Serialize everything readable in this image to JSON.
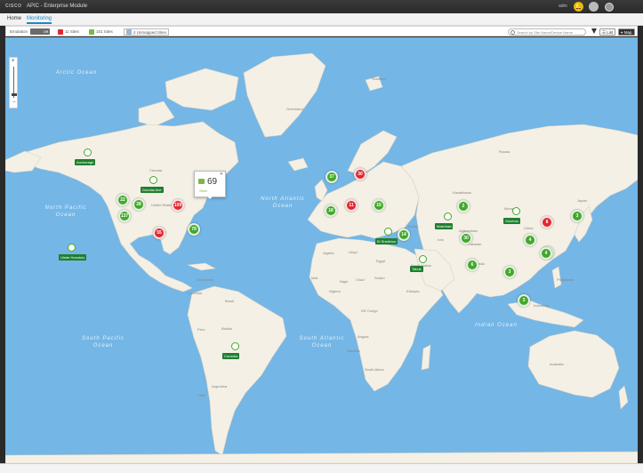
{
  "window": {
    "logo": "CISCO",
    "title": "APIC - Enterprise Module",
    "user": "adm"
  },
  "nav": {
    "tabs": [
      "Home",
      "Monitoring"
    ],
    "active": "Monitoring"
  },
  "toolbar": {
    "emulation_label": "Emulation",
    "emulation_toggle": "Off",
    "unreachable_label": "11 Sites",
    "reachable_label": "101 Sites",
    "unmapped_label": "4 Unmapped Sites",
    "search_placeholder": "Search by Site Name/Device Name",
    "list_label": "List",
    "map_label": "Map"
  },
  "colors": {
    "green": "#43a82b",
    "red": "#e0282f",
    "label_bg": "#1e7f2e",
    "ocean": "#74b6e6",
    "land": "#f4f0e6"
  },
  "map": {
    "oceans": [
      "Arctic Ocean",
      "North Pacific Ocean",
      "North Atlantic Ocean",
      "South Pacific Ocean",
      "South Atlantic Ocean",
      "Indian Ocean"
    ],
    "countries": [
      "Canada",
      "United States",
      "Mexico",
      "Brazil",
      "Peru",
      "Argentina",
      "Venezuela",
      "Colombia",
      "Bolivia",
      "Chile",
      "Greenland",
      "Russia",
      "Kazakhstan",
      "Mongolia",
      "China",
      "India",
      "Iran",
      "Saudi Arabia",
      "Egypt",
      "Libya",
      "Algeria",
      "Sudan",
      "Nigeria",
      "Chad",
      "Niger",
      "Mali",
      "DR Congo",
      "Angola",
      "Ethiopia",
      "South Africa",
      "Namibia",
      "Australia",
      "Indonesia",
      "Turkey",
      "Afghanistan",
      "Pakistan",
      "Japan",
      "Philippines",
      "Svalbard"
    ],
    "clusters": [
      {
        "count": "22",
        "status": "green"
      },
      {
        "count": "28",
        "status": "green"
      },
      {
        "count": "137",
        "status": "green"
      },
      {
        "count": "109",
        "status": "red"
      },
      {
        "count": "55",
        "status": "red"
      },
      {
        "count": "79",
        "status": "green"
      },
      {
        "count": "37",
        "status": "green"
      },
      {
        "count": "30",
        "status": "red"
      },
      {
        "count": "11",
        "status": "red"
      },
      {
        "count": "15",
        "status": "green"
      },
      {
        "count": "18",
        "status": "green"
      },
      {
        "count": "2",
        "status": "green"
      },
      {
        "count": "14",
        "status": "green"
      },
      {
        "count": "30",
        "status": "green"
      },
      {
        "count": "6",
        "status": "green"
      },
      {
        "count": "4",
        "status": "green"
      },
      {
        "count": "3",
        "status": "green"
      },
      {
        "count": "2",
        "status": "green"
      },
      {
        "count": "3",
        "status": "green"
      },
      {
        "count": "4",
        "status": "green"
      },
      {
        "count": "8",
        "status": "red"
      },
      {
        "count": "3",
        "status": "green"
      }
    ],
    "site_labels": [
      "Anchorage",
      "Dundas Ave",
      "Ulster Honolulu",
      "El Sheikhun",
      "Mashhad",
      "Guizhou",
      "Tabuk",
      "Cordoba"
    ],
    "popup": {
      "count": "69",
      "label": "Sites"
    }
  }
}
